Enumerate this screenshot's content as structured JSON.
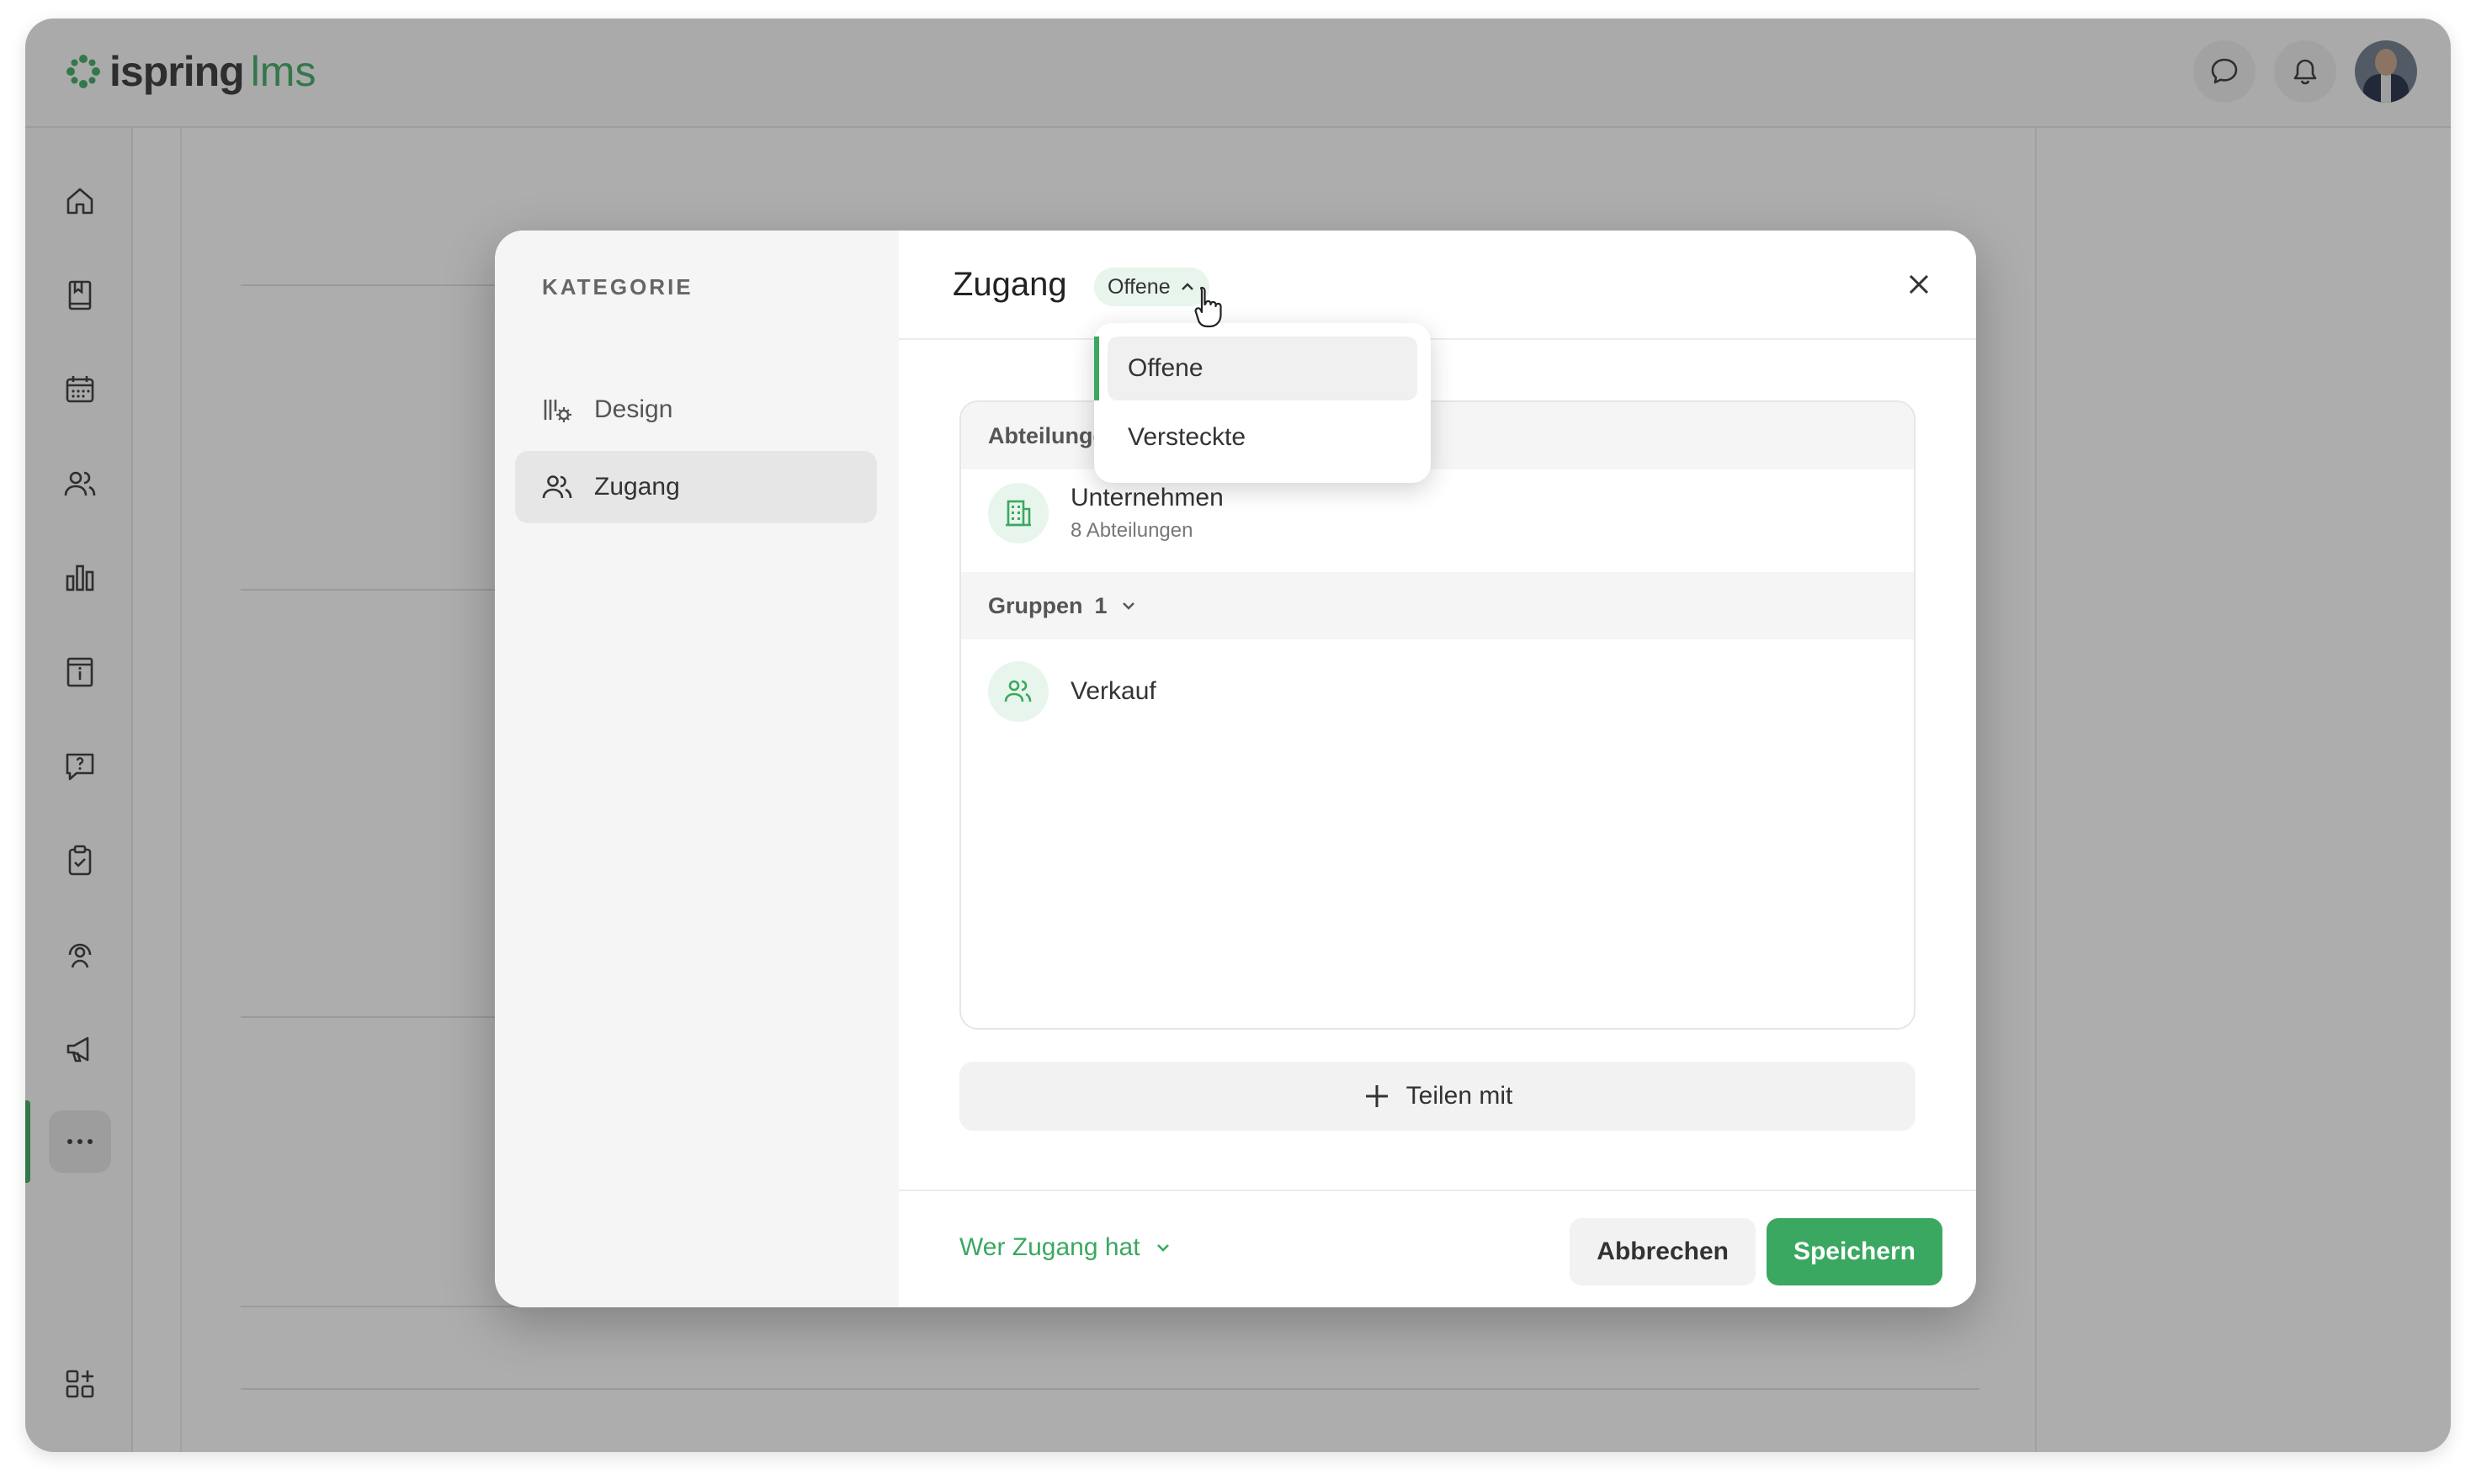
{
  "app": {
    "logo_text": "ispring",
    "logo_suffix": "lms"
  },
  "sidebar": {
    "items": [
      {
        "icon": "home-icon"
      },
      {
        "icon": "book-icon"
      },
      {
        "icon": "calendar-icon"
      },
      {
        "icon": "users-icon"
      },
      {
        "icon": "bar-chart-icon"
      },
      {
        "icon": "info-panel-icon"
      },
      {
        "icon": "question-chat-icon"
      },
      {
        "icon": "clipboard-check-icon"
      },
      {
        "icon": "support-agent-icon"
      },
      {
        "icon": "megaphone-icon"
      },
      {
        "icon": "more-icon",
        "active": true
      }
    ],
    "bottom_icon": "add-widget-icon"
  },
  "modal": {
    "category_label": "KATEGORIE",
    "nav": [
      {
        "label": "Design",
        "icon": "design-settings-icon"
      },
      {
        "label": "Zugang",
        "icon": "users-icon",
        "active": true
      }
    ],
    "title": "Zugang",
    "status_pill": "Offene",
    "dropdown": {
      "options": [
        "Offene",
        "Versteckte"
      ],
      "selected": "Offene"
    },
    "sections": [
      {
        "header": "Abteilungen",
        "items": [
          {
            "name": "Unternehmen",
            "sub": "8 Abteilungen",
            "icon": "building-icon"
          }
        ]
      },
      {
        "header": "Gruppen",
        "count": "1",
        "items": [
          {
            "name": "Verkauf",
            "icon": "users-icon"
          }
        ]
      }
    ],
    "share_label": "Teilen mit",
    "who_has_access": "Wer Zugang hat",
    "cancel_label": "Abbrechen",
    "save_label": "Speichern"
  },
  "colors": {
    "accent": "#3aa860",
    "accent_light": "#e8f5ec"
  }
}
